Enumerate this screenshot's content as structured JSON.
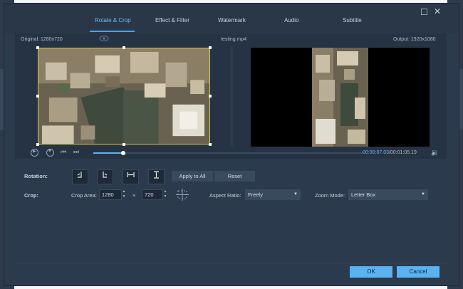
{
  "tabs": [
    {
      "label": "Rotate & Crop"
    },
    {
      "label": "Effect & Filter"
    },
    {
      "label": "Watermark"
    },
    {
      "label": "Audio"
    },
    {
      "label": "Subtitle"
    }
  ],
  "info": {
    "original": "Original: 1280x720",
    "filename": "testing.mp4",
    "output": "Output: 1920x1080"
  },
  "player": {
    "current_time": "00:00:07.03",
    "total_time": "/00:01:05.19",
    "progress_fraction": 0.11
  },
  "rotation": {
    "label": "Rotation:",
    "apply_all": "Apply to All",
    "reset": "Reset"
  },
  "crop": {
    "label": "Crop:",
    "area_label": "Crop Area:",
    "width": "1280",
    "times": "×",
    "height": "720",
    "aspect_label": "Aspect Ratio:",
    "aspect_value": "Freely",
    "zoom_label": "Zoom Mode:",
    "zoom_value": "Letter Box"
  },
  "footer": {
    "ok": "OK",
    "cancel": "Cancel"
  },
  "colors": {
    "accent": "#47a4ee",
    "dialog_bg": "#2c3a4d",
    "crop_frame": "#d9c63c"
  }
}
